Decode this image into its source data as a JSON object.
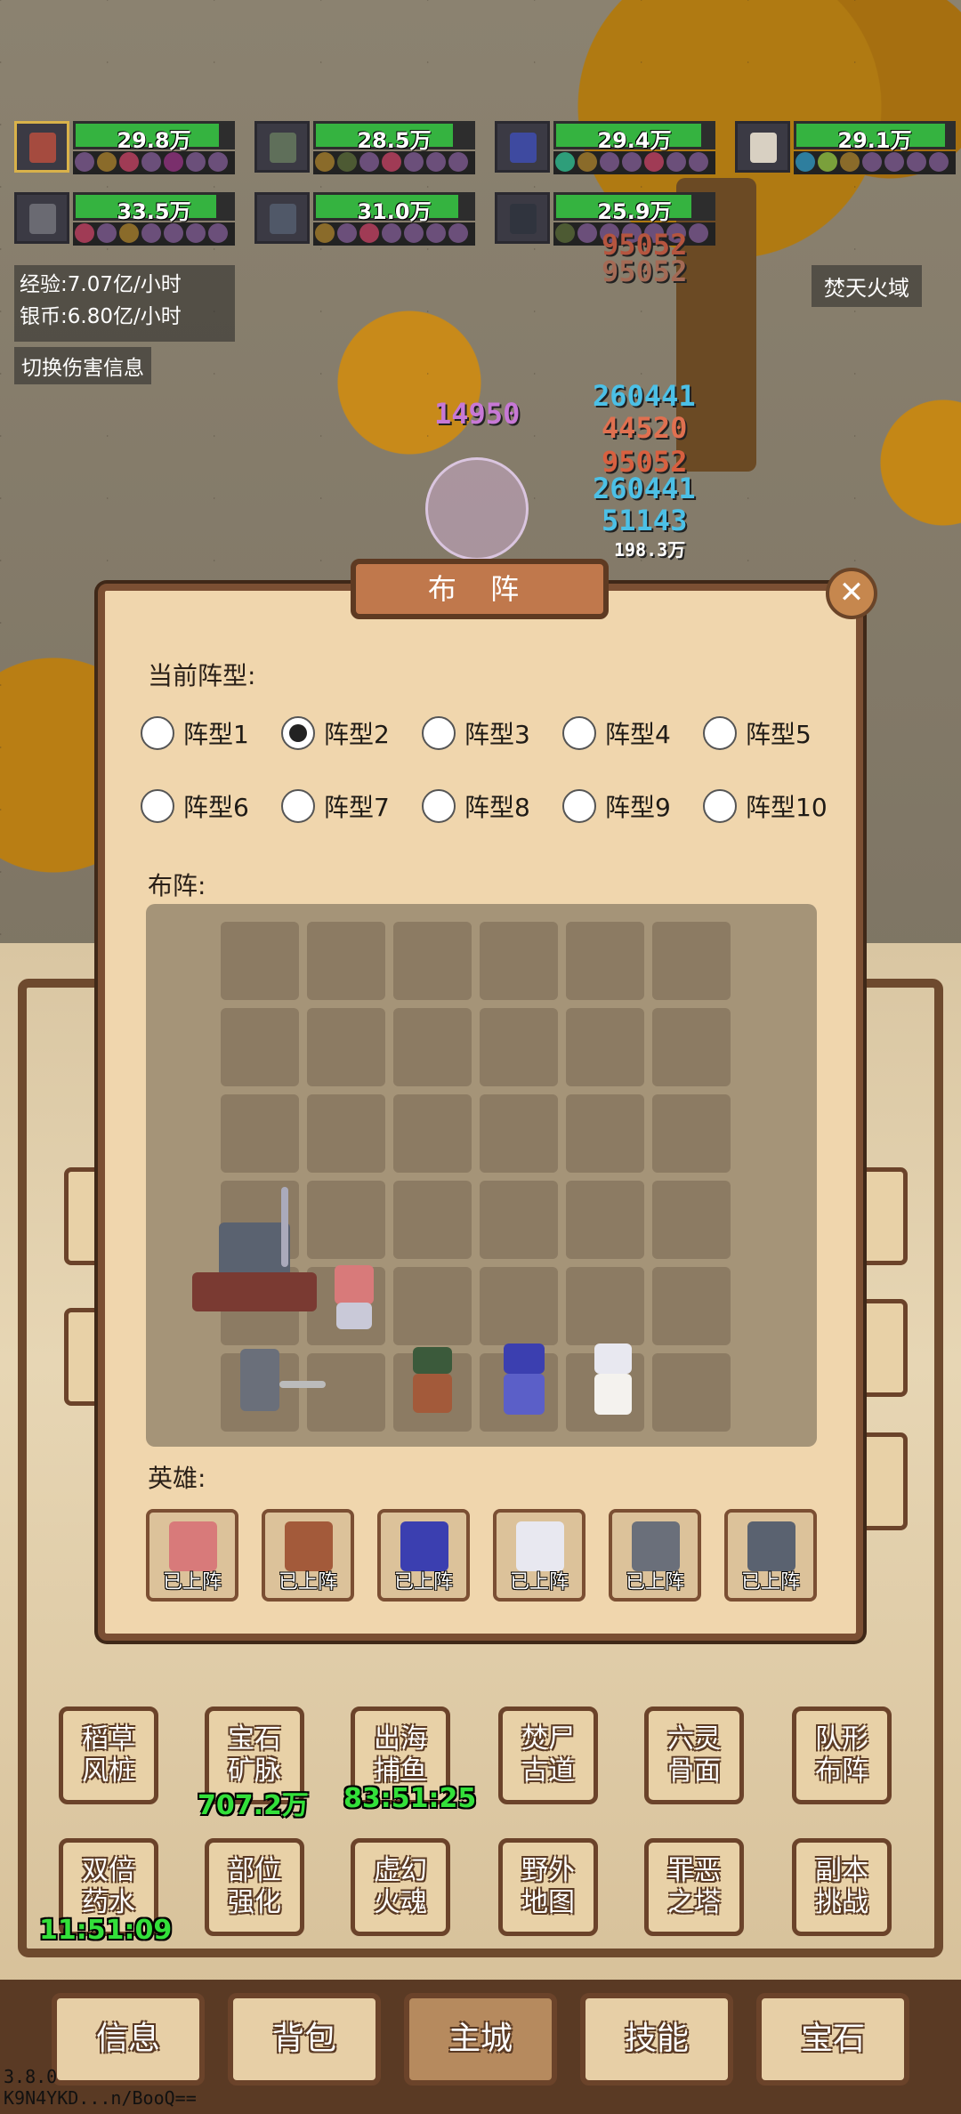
{
  "heroes_top": [
    {
      "power": "29.8万",
      "hp": 0.92
    },
    {
      "power": "28.5万",
      "hp": 0.88
    },
    {
      "power": "29.4万",
      "hp": 0.93
    },
    {
      "power": "29.1万",
      "hp": 0.95
    },
    {
      "power": "33.5万",
      "hp": 0.9
    },
    {
      "power": "31.0万",
      "hp": 0.91
    },
    {
      "power": "25.9万",
      "hp": 0.87
    }
  ],
  "stats": {
    "exp": "经验:7.07亿/小时",
    "silver": "银币:6.80亿/小时"
  },
  "toggle_damage": "切换伤害信息",
  "zone": "焚天火域",
  "damage_numbers": [
    "95052",
    "95052",
    "14950",
    "260441",
    "44520",
    "95052",
    "260441",
    "51143",
    "198.3万"
  ],
  "dialog": {
    "title": "布 阵",
    "close": "✕",
    "formation_label": "当前阵型:",
    "layout_label": "布阵:",
    "heroes_label": "英雄:",
    "selected_formation": "阵型2",
    "formations": [
      "阵型1",
      "阵型2",
      "阵型3",
      "阵型4",
      "阵型5",
      "阵型6",
      "阵型7",
      "阵型8",
      "阵型9",
      "阵型10"
    ],
    "deployed_tag": "已上阵",
    "hero_slots": 6
  },
  "town_buttons": [
    {
      "label": "稻草\n风桩"
    },
    {
      "label": "宝石\n矿脉",
      "timer": "707.2万"
    },
    {
      "label": "出海\n捕鱼",
      "timer": "83:51:25"
    },
    {
      "label": "焚尸\n古道"
    },
    {
      "label": "六灵\n骨面"
    },
    {
      "label": "队形\n布阵"
    },
    {
      "label": "双倍\n药水",
      "timer": "11:51:09"
    },
    {
      "label": "部位\n强化"
    },
    {
      "label": "虚幻\n火魂"
    },
    {
      "label": "野外\n地图"
    },
    {
      "label": "罪恶\n之塔"
    },
    {
      "label": "副本\n挑战"
    }
  ],
  "tabs": [
    "信息",
    "背包",
    "主城",
    "技能",
    "宝石"
  ],
  "active_tab": "主城",
  "version": "3.8.0",
  "build_id": "K9N4YKD...n/BooQ=="
}
